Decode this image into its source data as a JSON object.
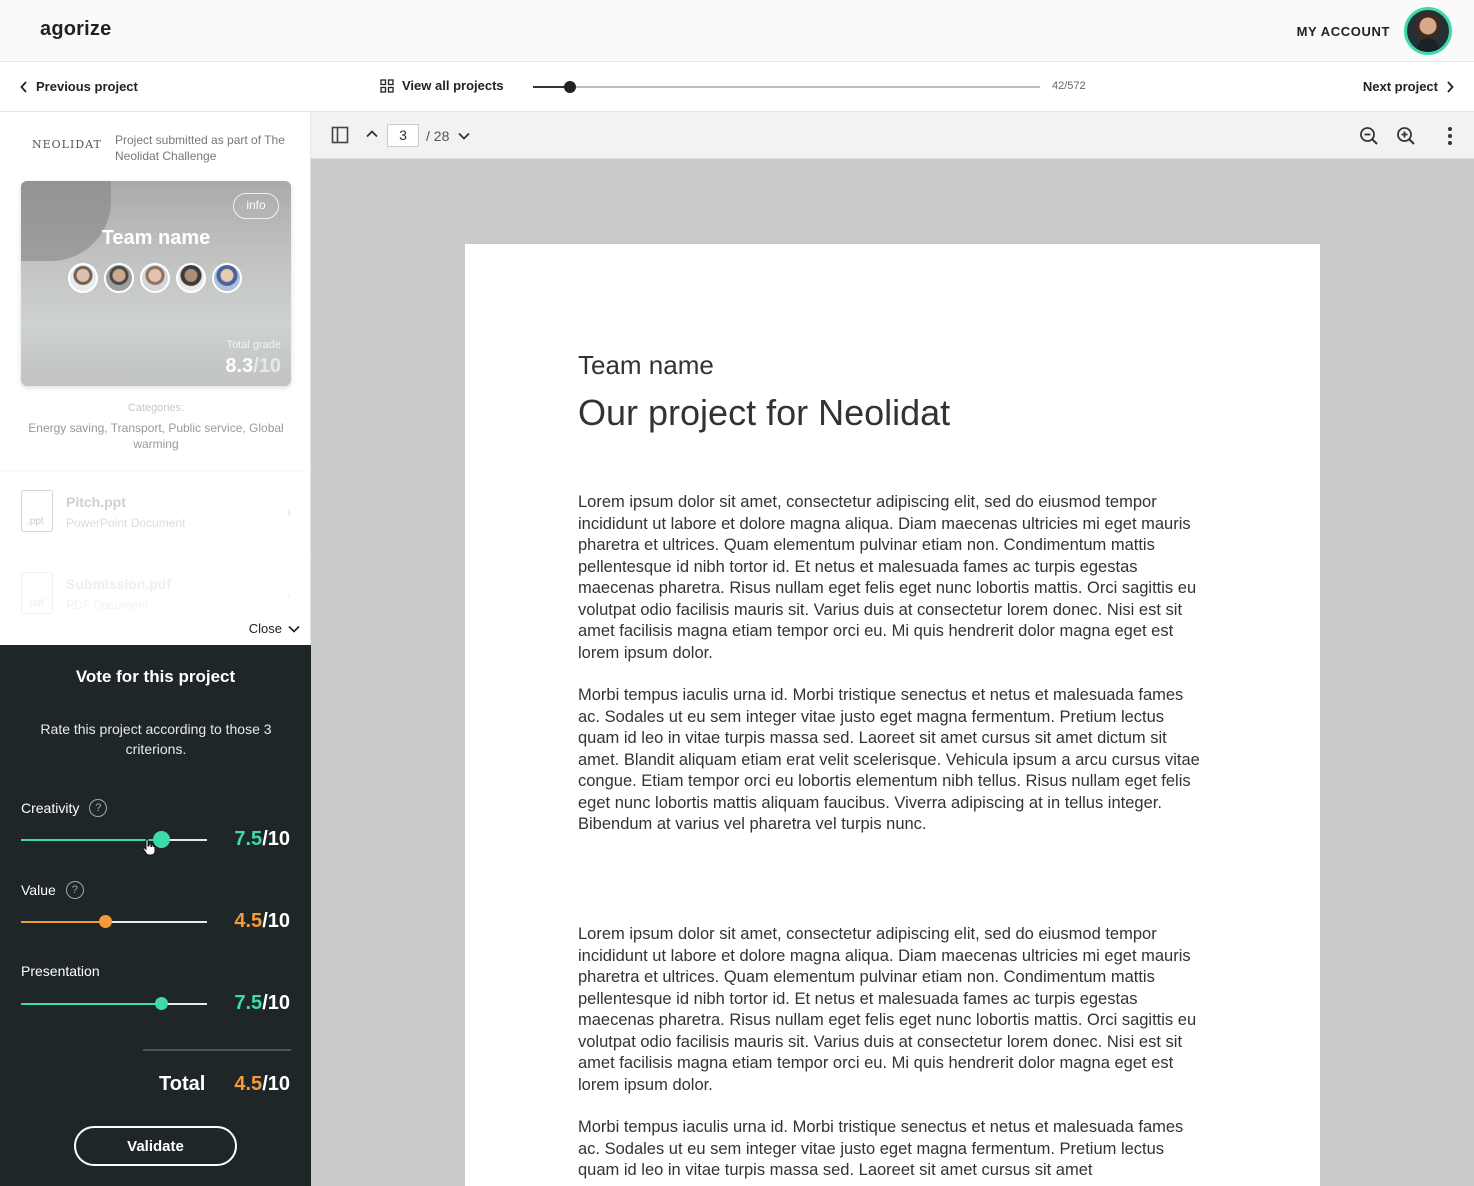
{
  "header": {
    "logo": "agorize",
    "account_label": "MY ACCOUNT"
  },
  "nav": {
    "previous_label": "Previous project",
    "view_all_label": "View all projects",
    "progress": {
      "current": 42,
      "total": 572,
      "label": "42/572"
    },
    "next_label": "Next project"
  },
  "project": {
    "brand_logo": "NEOLIDAT",
    "submitted_text": "Project submitted as part of The Neolidat Challenge",
    "card": {
      "info_label": "info",
      "team_name": "Team name",
      "total_grade_label": "Total grade",
      "total_grade_value": "8.3",
      "total_grade_den": "/10"
    },
    "categories_label": "Categories:",
    "categories": "Energy saving, Transport, Public service, Global warming",
    "files": [
      {
        "name": "Pitch.ppt",
        "type": "PowerPoint Document",
        "ext": ".ppt"
      },
      {
        "name": "Submission.pdf",
        "type": "PDF Document",
        "ext": ".pdf"
      }
    ],
    "close_label": "Close"
  },
  "vote": {
    "title": "Vote for this project",
    "description": "Rate this project according to those 3 criterions.",
    "criteria": [
      {
        "label": "Creativity",
        "score": "7.5",
        "den": "/10",
        "value": 7.5,
        "color": "#3ddba8",
        "help": "?"
      },
      {
        "label": "Value",
        "score": "4.5",
        "den": "/10",
        "value": 4.5,
        "color": "#f39a3a",
        "help": "?"
      },
      {
        "label": "Presentation",
        "score": "7.5",
        "den": "/10",
        "value": 7.5,
        "color": "#3ddba8"
      }
    ],
    "total_label": "Total",
    "total_score": "4.5",
    "total_den": "/10",
    "validate_label": "Validate"
  },
  "viewer": {
    "current_page": "3",
    "total_pages": "/ 28"
  },
  "document": {
    "team_name": "Team name",
    "title": "Our project for Neolidat",
    "paragraphs": [
      "Lorem ipsum dolor sit amet, consectetur adipiscing elit, sed do eiusmod tempor incididunt ut labore et dolore magna aliqua. Diam maecenas ultricies mi eget mauris pharetra et ultrices. Quam elementum pulvinar etiam non. Condimentum mattis pellentesque id nibh tortor id. Et netus et malesuada fames ac turpis egestas maecenas pharetra. Risus nullam eget felis eget nunc lobortis mattis. Orci sagittis eu volutpat odio facilisis mauris sit. Varius duis at consectetur lorem donec. Nisi est sit amet facilisis magna etiam tempor orci eu. Mi quis hendrerit dolor magna eget est lorem ipsum dolor.",
      "Morbi tempus iaculis urna id. Morbi tristique senectus et netus et malesuada fames ac. Sodales ut eu sem integer vitae justo eget magna fermentum. Pretium lectus quam id leo in vitae turpis massa sed. Laoreet sit amet cursus sit amet dictum sit amet. Blandit aliquam etiam erat velit scelerisque. Vehicula ipsum a arcu cursus vitae congue. Etiam tempor orci eu lobortis elementum nibh tellus. Risus nullam eget felis eget nunc lobortis mattis aliquam faucibus. Viverra adipiscing at in tellus integer. Bibendum at varius vel pharetra vel turpis nunc.",
      "Lorem ipsum dolor sit amet, consectetur adipiscing elit, sed do eiusmod tempor incididunt ut labore et dolore magna aliqua. Diam maecenas ultricies mi eget mauris pharetra et ultrices. Quam elementum pulvinar etiam non. Condimentum mattis pellentesque id nibh tortor id. Et netus et malesuada fames ac turpis egestas maecenas pharetra. Risus nullam eget felis eget nunc lobortis mattis. Orci sagittis eu volutpat odio facilisis mauris sit. Varius duis at consectetur lorem donec. Nisi est sit amet facilisis magna etiam tempor orci eu. Mi quis hendrerit dolor magna eget est lorem ipsum dolor.",
      "Morbi tempus iaculis urna id. Morbi tristique senectus et netus et malesuada fames ac. Sodales ut eu sem integer vitae justo eget magna fermentum. Pretium lectus quam id leo in vitae turpis massa sed. Laoreet sit amet cursus sit amet"
    ]
  },
  "colors": {
    "accent_green": "#3ddba8",
    "accent_orange": "#f39a3a",
    "vote_panel_bg": "#1f2628",
    "viewer_bg": "#c9cbca"
  }
}
